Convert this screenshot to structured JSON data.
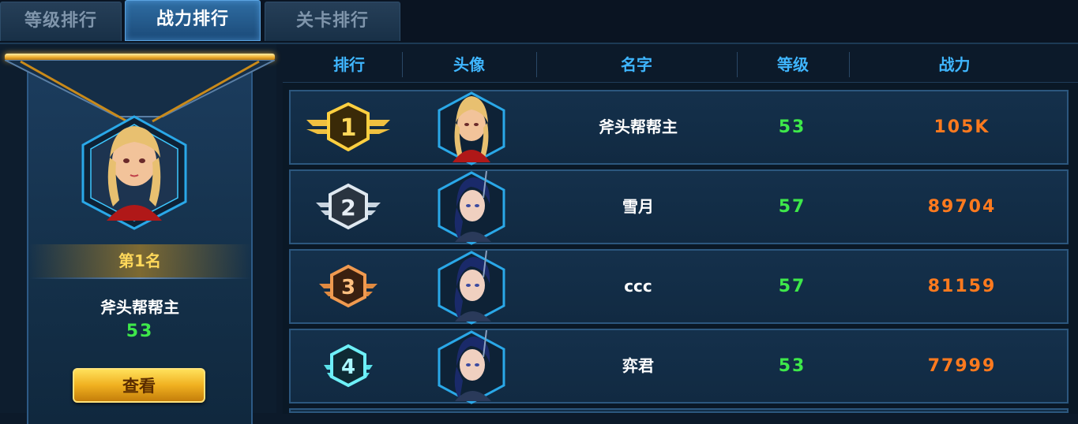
{
  "tabs": [
    {
      "label": "等级排行",
      "active": false
    },
    {
      "label": "战力排行",
      "active": true
    },
    {
      "label": "关卡排行",
      "active": false
    }
  ],
  "top_player": {
    "rank_label": "第1名",
    "name": "斧头帮帮主",
    "level": "53",
    "view_button": "查看"
  },
  "table": {
    "headers": [
      "排行",
      "头像",
      "名字",
      "等级",
      "战力"
    ],
    "rows": [
      {
        "rank": "1",
        "name": "斧头帮帮主",
        "level": "53",
        "power": "105K",
        "badge": "gold",
        "avatar": "blonde-avatar-icon"
      },
      {
        "rank": "2",
        "name": "雪月",
        "level": "57",
        "power": "89704",
        "badge": "silver",
        "avatar": "dark-haired-avatar-icon"
      },
      {
        "rank": "3",
        "name": "ccc",
        "level": "57",
        "power": "81159",
        "badge": "bronze",
        "avatar": "dark-haired-avatar-icon"
      },
      {
        "rank": "4",
        "name": "弈君",
        "level": "53",
        "power": "77999",
        "badge": "cyan",
        "avatar": "dark-haired-avatar-icon"
      }
    ]
  },
  "colors": {
    "accent_blue": "#3fb6ff",
    "level_green": "#3ee84a",
    "power_orange": "#ff7a1e",
    "gold": "#f0b030"
  }
}
